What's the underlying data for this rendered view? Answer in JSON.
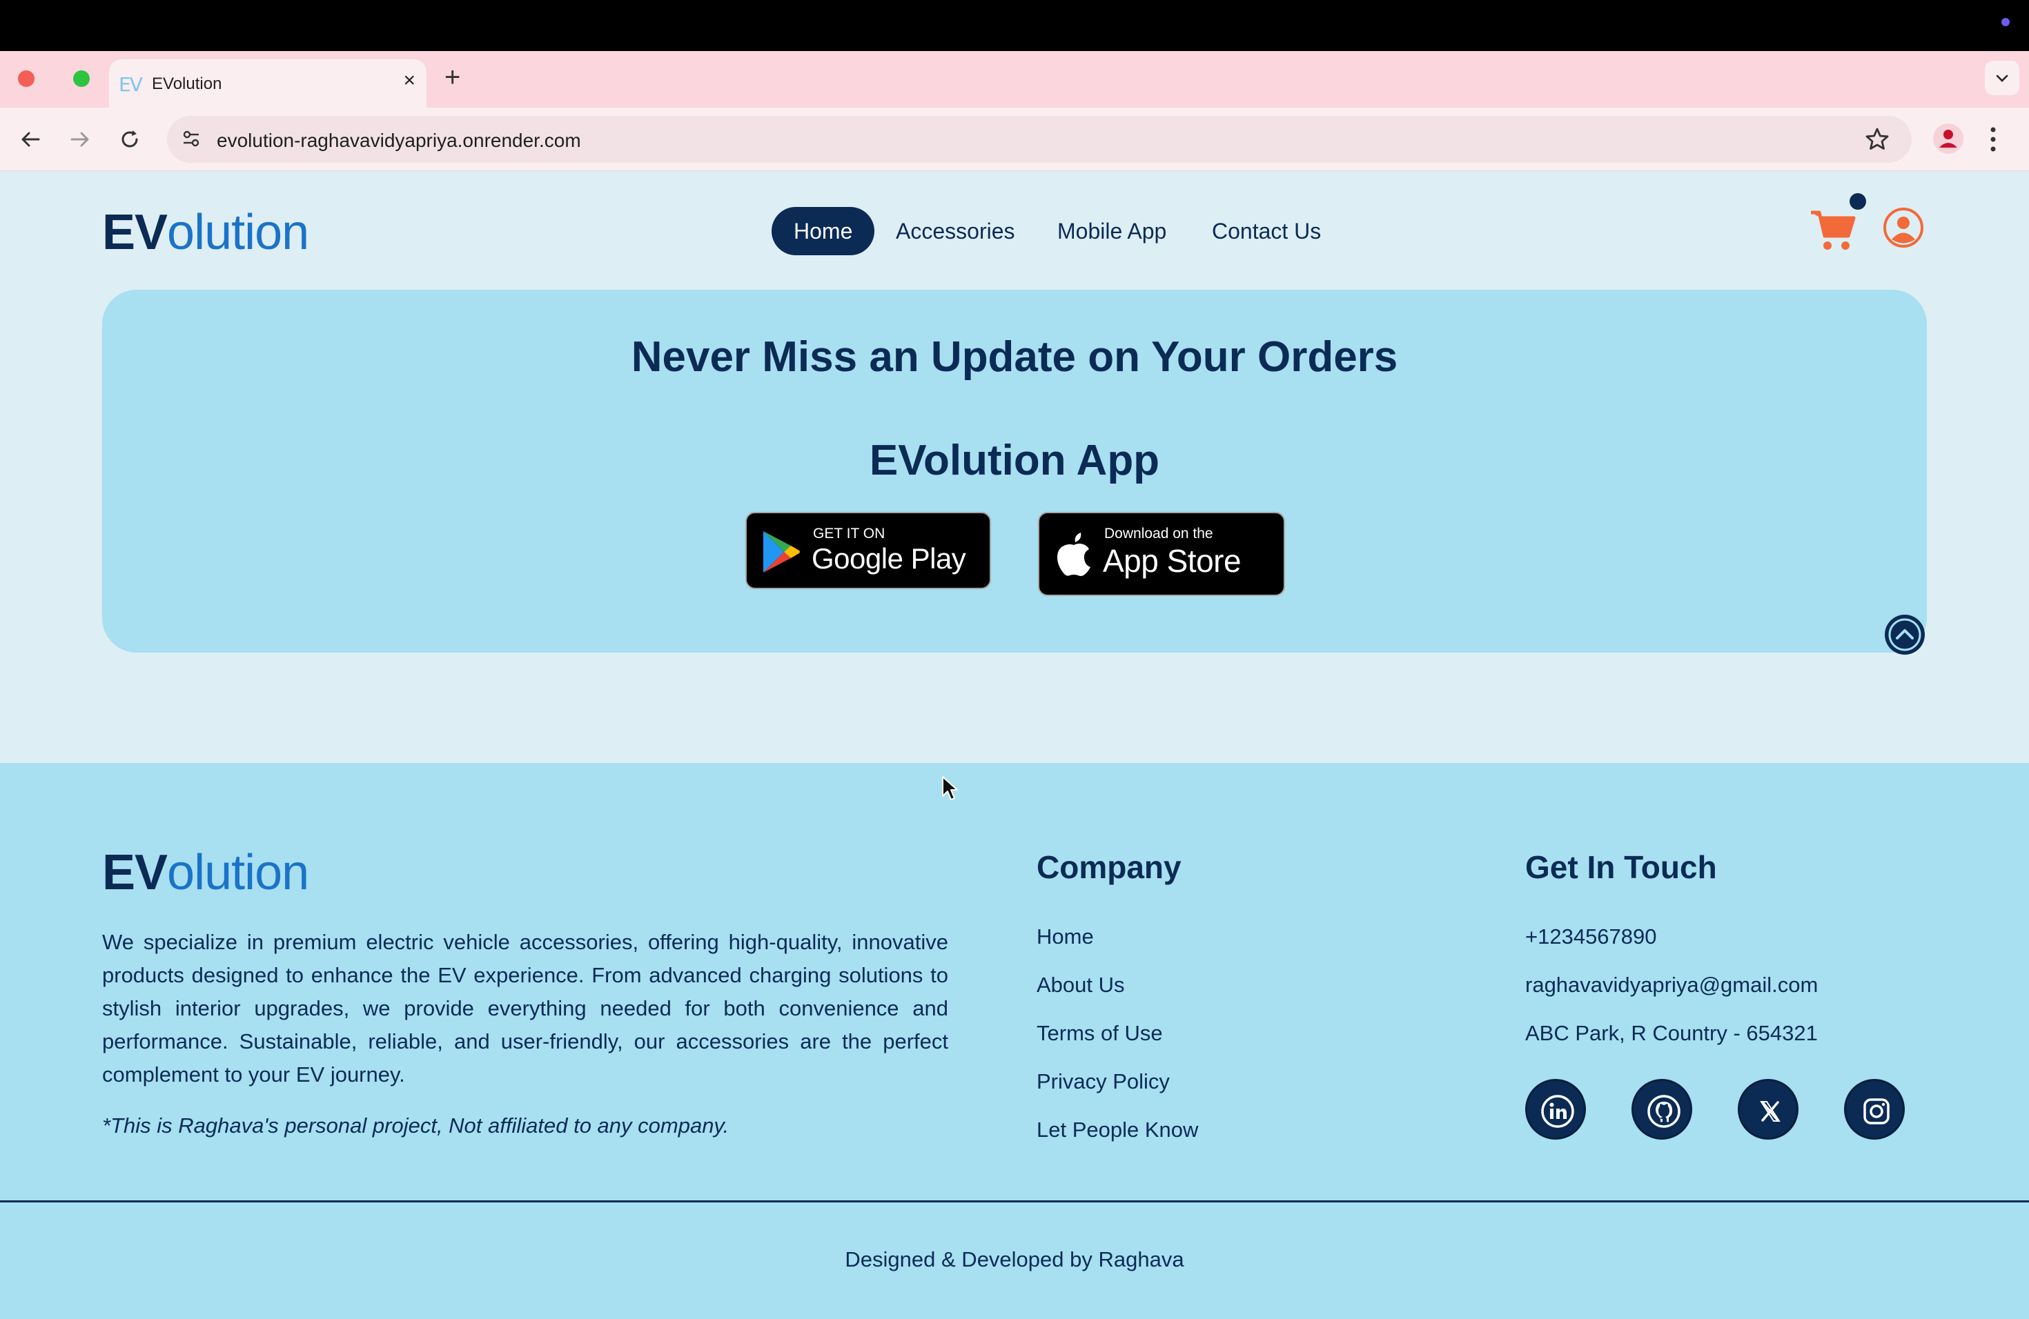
{
  "browser": {
    "tab_title": "EVolution",
    "tab_favicon": "EV",
    "new_tab": "+",
    "close": "×",
    "url": "evolution-raghavavidyapriya.onrender.com"
  },
  "site": {
    "logo_ev": "EV",
    "logo_rest": "olution",
    "nav": [
      "Home",
      "Accessories",
      "Mobile App",
      "Contact Us"
    ],
    "active_nav": "Home"
  },
  "promo": {
    "title": "Never Miss an Update on Your Orders",
    "subtitle": "EVolution App",
    "google_play": {
      "small": "GET IT ON",
      "big": "Google Play"
    },
    "app_store": {
      "small": "Download on the",
      "big": "App Store"
    }
  },
  "footer": {
    "about": "We specialize in premium electric vehicle accessories, offering high-quality, innovative products designed to enhance the EV experience. From advanced charging solutions to stylish interior upgrades, we provide everything needed for both convenience and performance. Sustainable, reliable, and user-friendly, our accessories are the perfect complement to your EV journey.",
    "disclaimer": "*This is Raghava's personal project, Not affiliated to any company.",
    "company_heading": "Company",
    "company_links": [
      "Home",
      "About Us",
      "Terms of Use",
      "Privacy Policy",
      "Let People Know"
    ],
    "contact_heading": "Get In Touch",
    "contact": [
      "+1234567890",
      "raghavavidyapriya@gmail.com",
      "ABC Park, R Country - 654321"
    ],
    "social_icons": [
      "linkedin-icon",
      "github-icon",
      "x-icon",
      "instagram-icon"
    ],
    "credit": "Designed & Developed by Raghava"
  },
  "colors": {
    "navy": "#0b2b55",
    "brand_blue": "#1a73c8",
    "accent_orange": "#f26a3a",
    "banner_bg": "#a8dff1",
    "page_bg": "#deeef5",
    "tabstrip": "#fbd6dd"
  }
}
